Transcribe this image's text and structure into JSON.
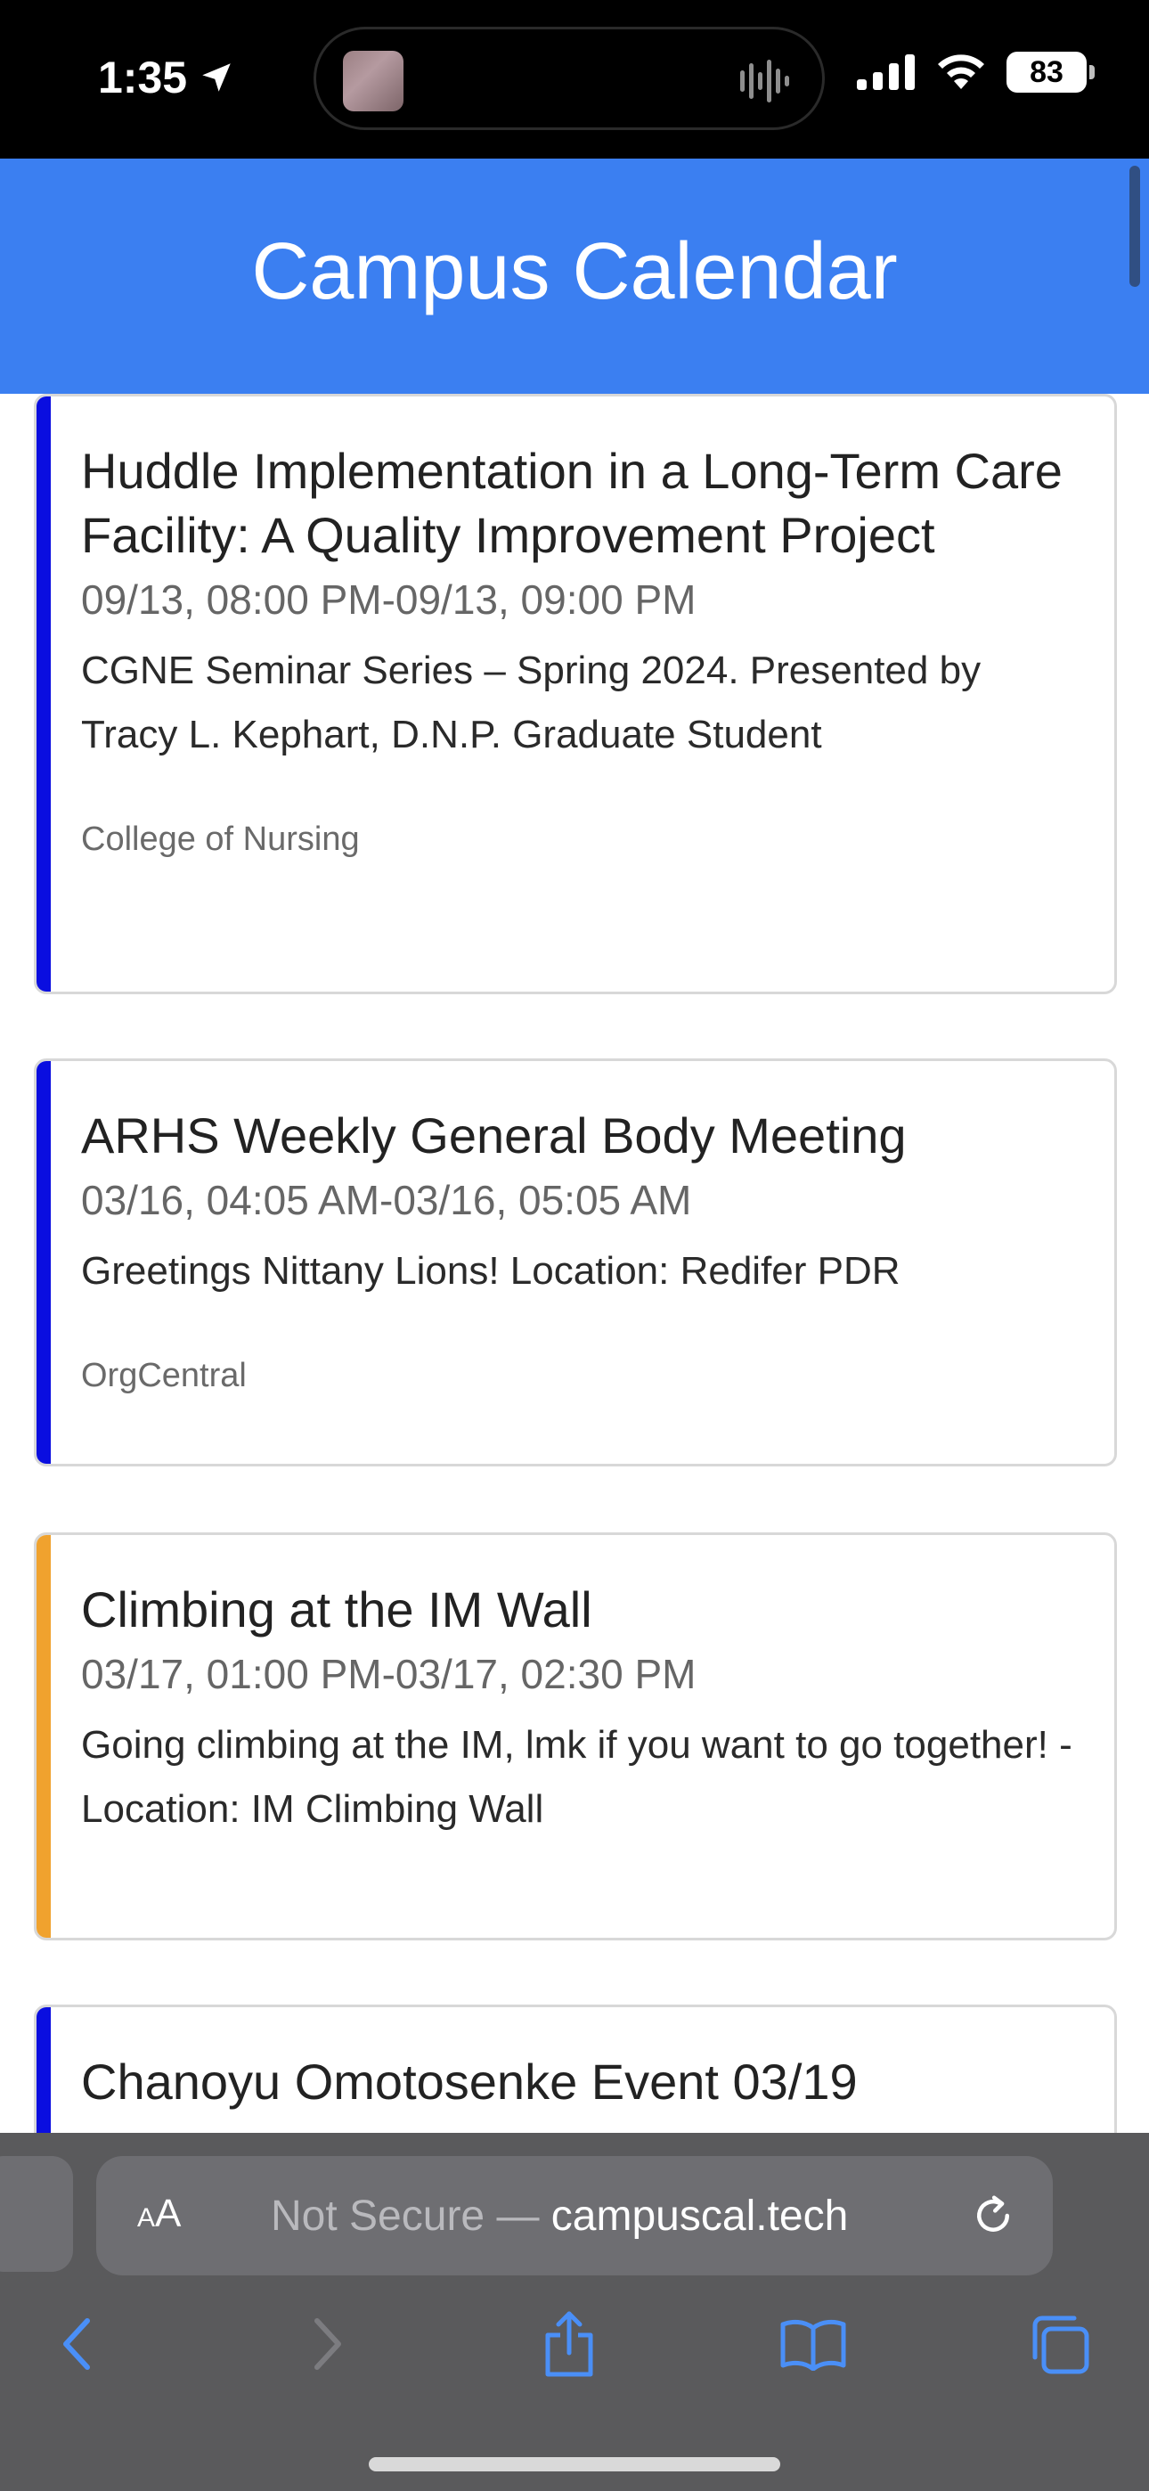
{
  "status_bar": {
    "time": "1:35",
    "battery": "83"
  },
  "header": {
    "title": "Campus Calendar"
  },
  "events": [
    {
      "title": "Huddle Implementation in a Long-Term Care Facility: A Quality Improvement Project",
      "time": "09/13, 08:00 PM-09/13, 09:00 PM",
      "description": "CGNE Seminar Series – Spring 2024. Presented by Tracy L. Kephart, D.N.P. Graduate Student",
      "organization": "College of Nursing",
      "accent_color": "#0a0ee0"
    },
    {
      "title": "ARHS Weekly General Body Meeting",
      "time": "03/16, 04:05 AM-03/16, 05:05 AM",
      "description": "Greetings Nittany Lions! Location: Redifer PDR",
      "organization": "OrgCentral",
      "accent_color": "#0a0ee0"
    },
    {
      "title": "Climbing at the IM Wall",
      "time": "03/17, 01:00 PM-03/17, 02:30 PM",
      "description": "Going climbing at the IM, lmk if you want to go together! - Location: IM Climbing Wall",
      "organization": "",
      "accent_color": "#f0a22e"
    },
    {
      "title": "Chanoyu Omotosenke Event 03/19",
      "accent_color": "#0a0ee0"
    }
  ],
  "browser": {
    "aa_label_small": "A",
    "aa_label_large": "A",
    "address_prefix": "Not Secure — ",
    "address_domain": "campuscal.tech"
  },
  "icons": {
    "location": "location-arrow-icon",
    "signal": "cellular-signal-icon",
    "wifi": "wifi-icon",
    "back": "chevron-left-icon",
    "forward": "chevron-right-icon",
    "share": "share-icon",
    "bookmarks": "book-icon",
    "tabs": "tabs-icon",
    "reload": "reload-icon"
  }
}
